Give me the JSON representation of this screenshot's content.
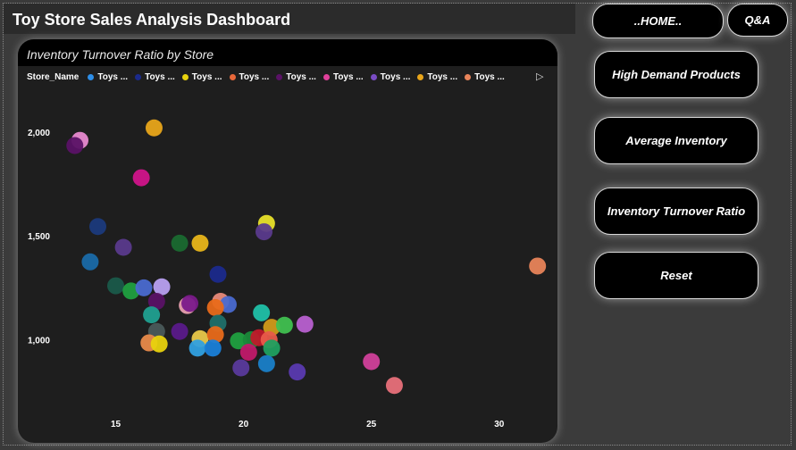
{
  "dashboard": {
    "title": "Toy Store Sales Analysis Dashboard"
  },
  "nav": {
    "home_label": "..HOME..",
    "qa_label": "Q&A",
    "high_demand_label": "High Demand Products",
    "avg_inventory_label": "Average Inventory",
    "turnover_label": "Inventory Turnover Ratio",
    "reset_label": "Reset"
  },
  "colors": {
    "background": "#3a3a3a",
    "card": "#1e1e1e",
    "button": "#000000"
  },
  "chart_data": {
    "type": "scatter",
    "title": "Inventory Turnover Ratio by Store",
    "legend_title": "Store_Name",
    "legend_position": "top-left",
    "legend_items": [
      {
        "label": "Toys ...",
        "color": "#2d8ee8"
      },
      {
        "label": "Toys ...",
        "color": "#1b2a8c"
      },
      {
        "label": "Toys ...",
        "color": "#e8d20e"
      },
      {
        "label": "Toys ...",
        "color": "#e8683a"
      },
      {
        "label": "Toys ...",
        "color": "#5a1266"
      },
      {
        "label": "Toys ...",
        "color": "#e0409a"
      },
      {
        "label": "Toys ...",
        "color": "#7a4cc4"
      },
      {
        "label": "Toys ...",
        "color": "#e8a51a"
      },
      {
        "label": "Toys ...",
        "color": "#e8845a"
      }
    ],
    "xlim": [
      12.5,
      32
    ],
    "ylim": [
      650,
      2180
    ],
    "xticks": [
      15,
      20,
      25,
      30
    ],
    "yticks": [
      1000,
      1500,
      2000
    ],
    "ytick_labels": [
      "1,000",
      "1,500",
      "2,000"
    ],
    "grid": false,
    "points": [
      {
        "x": 13.6,
        "y": 1960,
        "color": "#e88ad0"
      },
      {
        "x": 13.4,
        "y": 1935,
        "color": "#5a1266"
      },
      {
        "x": 16.5,
        "y": 2020,
        "color": "#e8a51a"
      },
      {
        "x": 16.0,
        "y": 1780,
        "color": "#d0148a"
      },
      {
        "x": 14.3,
        "y": 1545,
        "color": "#1b3a7c"
      },
      {
        "x": 15.3,
        "y": 1445,
        "color": "#5a3a8c"
      },
      {
        "x": 17.5,
        "y": 1465,
        "color": "#1a6a30"
      },
      {
        "x": 18.3,
        "y": 1465,
        "color": "#e8b51a"
      },
      {
        "x": 20.9,
        "y": 1560,
        "color": "#e8e02a"
      },
      {
        "x": 20.8,
        "y": 1520,
        "color": "#5a3a8c"
      },
      {
        "x": 14.0,
        "y": 1375,
        "color": "#1a6aa8"
      },
      {
        "x": 19.0,
        "y": 1315,
        "color": "#1b2a8c"
      },
      {
        "x": 15.0,
        "y": 1260,
        "color": "#1a5a4a"
      },
      {
        "x": 15.6,
        "y": 1235,
        "color": "#20a040"
      },
      {
        "x": 16.1,
        "y": 1250,
        "color": "#4a6ad0"
      },
      {
        "x": 16.8,
        "y": 1255,
        "color": "#b8a0f0"
      },
      {
        "x": 16.6,
        "y": 1185,
        "color": "#5a1266"
      },
      {
        "x": 16.4,
        "y": 1120,
        "color": "#20a090"
      },
      {
        "x": 17.8,
        "y": 1165,
        "color": "#e8a0b0"
      },
      {
        "x": 17.9,
        "y": 1175,
        "color": "#7a1a8a"
      },
      {
        "x": 19.1,
        "y": 1185,
        "color": "#e88a7a"
      },
      {
        "x": 19.4,
        "y": 1170,
        "color": "#4a6ad0"
      },
      {
        "x": 18.9,
        "y": 1155,
        "color": "#e86a1a"
      },
      {
        "x": 19.0,
        "y": 1080,
        "color": "#20706a"
      },
      {
        "x": 20.7,
        "y": 1130,
        "color": "#20c0a8"
      },
      {
        "x": 17.5,
        "y": 1040,
        "color": "#5a1a8a"
      },
      {
        "x": 16.6,
        "y": 1040,
        "color": "#4a5a5a"
      },
      {
        "x": 16.3,
        "y": 985,
        "color": "#e88a4a"
      },
      {
        "x": 16.7,
        "y": 980,
        "color": "#e8d20e"
      },
      {
        "x": 18.3,
        "y": 1005,
        "color": "#e8c84a"
      },
      {
        "x": 18.9,
        "y": 1025,
        "color": "#e86a1a"
      },
      {
        "x": 18.2,
        "y": 960,
        "color": "#30a0e0"
      },
      {
        "x": 18.8,
        "y": 960,
        "color": "#1a80d8"
      },
      {
        "x": 19.8,
        "y": 995,
        "color": "#20a040"
      },
      {
        "x": 20.3,
        "y": 1000,
        "color": "#1a8a3a"
      },
      {
        "x": 20.6,
        "y": 1010,
        "color": "#c01a2a"
      },
      {
        "x": 21.1,
        "y": 1060,
        "color": "#d09a1a"
      },
      {
        "x": 21.6,
        "y": 1070,
        "color": "#40c050"
      },
      {
        "x": 22.4,
        "y": 1075,
        "color": "#b860d0"
      },
      {
        "x": 21.0,
        "y": 1000,
        "color": "#e85a4a"
      },
      {
        "x": 21.1,
        "y": 960,
        "color": "#20a060"
      },
      {
        "x": 20.2,
        "y": 940,
        "color": "#c01a6a"
      },
      {
        "x": 20.9,
        "y": 885,
        "color": "#1a80c8"
      },
      {
        "x": 19.9,
        "y": 865,
        "color": "#5a3a9c"
      },
      {
        "x": 22.1,
        "y": 845,
        "color": "#5a3ab0"
      },
      {
        "x": 25.0,
        "y": 895,
        "color": "#d0409a"
      },
      {
        "x": 25.9,
        "y": 780,
        "color": "#e8707a"
      },
      {
        "x": 31.5,
        "y": 1355,
        "color": "#e8845a"
      }
    ]
  }
}
